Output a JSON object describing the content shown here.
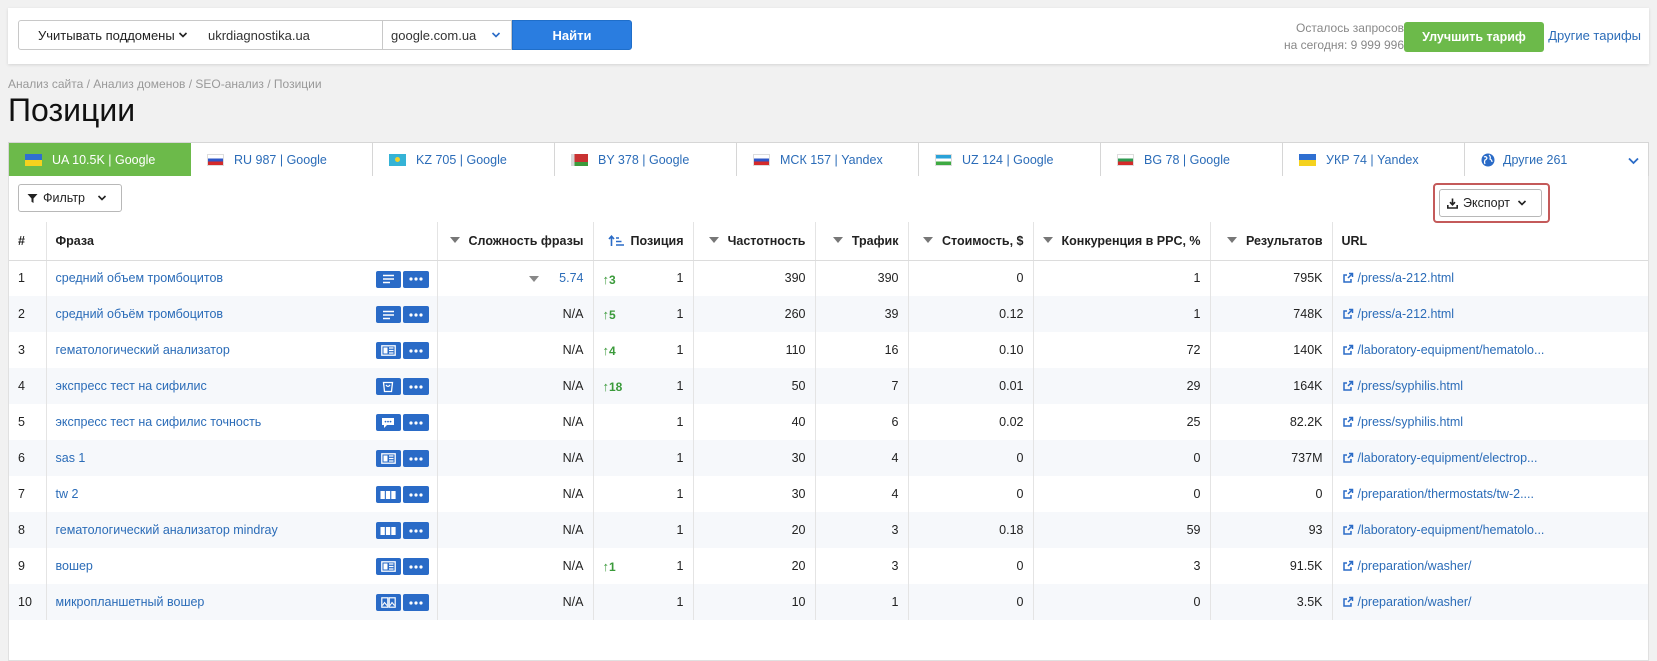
{
  "topbar": {
    "subdomain_select": "Учитывать поддомены",
    "domain_value": "ukrdiagnostika.ua",
    "domain_placeholder": "",
    "engine_select": "google.com.ua",
    "find_button": "Найти",
    "requests_line1": "Осталось запросов",
    "requests_line2": "на сегодня: 9 999 996",
    "upgrade_button": "Улучшить тариф",
    "other_plans_link": "Другие тарифы"
  },
  "breadcrumb": "Анализ сайта / Анализ доменов / SEO-анализ / Позиции",
  "page_title": "Позиции",
  "db_tabs": [
    {
      "label": "UA 10.5K | Google",
      "flag": "flag-ua",
      "active": true
    },
    {
      "label": "RU 987 | Google",
      "flag": "flag-ru"
    },
    {
      "label": "KZ 705 | Google",
      "flag": "flag-kz"
    },
    {
      "label": "BY 378 | Google",
      "flag": "flag-by"
    },
    {
      "label": "МСК 157 | Yandex",
      "flag": "flag-ru"
    },
    {
      "label": "UZ 124 | Google",
      "flag": "flag-uz"
    },
    {
      "label": "BG 78 | Google",
      "flag": "flag-bg"
    },
    {
      "label": "УКР 74 | Yandex",
      "flag": "flag-ua"
    },
    {
      "label": "Другие 261",
      "flag": "globe-icon"
    }
  ],
  "toolbar": {
    "filter_button": "Фильтр",
    "export_button": "Экспорт"
  },
  "table": {
    "headers": {
      "num": "#",
      "phrase": "Фраза",
      "difficulty": "Сложность фразы",
      "position": "Позиция",
      "frequency": "Частотность",
      "traffic": "Трафик",
      "cost": "Стоимость, $",
      "competition": "Конкуренция в PPC, %",
      "results": "Результатов",
      "url": "URL"
    },
    "rows": [
      {
        "n": "1",
        "phrase": "средний объем тромбоцитов",
        "icon": "text-lines-icon",
        "difficulty": "5.74",
        "delta": "3",
        "position": "1",
        "frequency": "390",
        "traffic": "390",
        "cost": "0",
        "competition": "1",
        "results": "795K",
        "url": "/press/a-212.html"
      },
      {
        "n": "2",
        "phrase": "средний объём тромбоцитов",
        "icon": "text-lines-icon",
        "difficulty": "N/A",
        "delta": "5",
        "position": "1",
        "frequency": "260",
        "traffic": "39",
        "cost": "0.12",
        "competition": "1",
        "results": "748K",
        "url": "/press/a-212.html"
      },
      {
        "n": "3",
        "phrase": "гематологический анализатор",
        "icon": "knowledge-panel-icon",
        "difficulty": "N/A",
        "delta": "4",
        "position": "1",
        "frequency": "110",
        "traffic": "16",
        "cost": "0.10",
        "competition": "72",
        "results": "140K",
        "url": "/laboratory-equipment/hematolo..."
      },
      {
        "n": "4",
        "phrase": "экспресс тест на сифилис",
        "icon": "shopping-bag-icon",
        "difficulty": "N/A",
        "delta": "18",
        "position": "1",
        "frequency": "50",
        "traffic": "7",
        "cost": "0.01",
        "competition": "29",
        "results": "164K",
        "url": "/press/syphilis.html"
      },
      {
        "n": "5",
        "phrase": "экспресс тест на сифилис точность",
        "icon": "chat-bubble-icon",
        "difficulty": "N/A",
        "delta": "",
        "position": "1",
        "frequency": "40",
        "traffic": "6",
        "cost": "0.02",
        "competition": "25",
        "results": "82.2K",
        "url": "/press/syphilis.html"
      },
      {
        "n": "6",
        "phrase": "sas 1",
        "icon": "knowledge-panel-icon",
        "difficulty": "N/A",
        "delta": "",
        "position": "1",
        "frequency": "30",
        "traffic": "4",
        "cost": "0",
        "competition": "0",
        "results": "737M",
        "url": "/laboratory-equipment/electrop..."
      },
      {
        "n": "7",
        "phrase": "tw 2",
        "icon": "columns-icon",
        "difficulty": "N/A",
        "delta": "",
        "position": "1",
        "frequency": "30",
        "traffic": "4",
        "cost": "0",
        "competition": "0",
        "results": "0",
        "url": "/preparation/thermostats/tw-2...."
      },
      {
        "n": "8",
        "phrase": "гематологический анализатор mindray",
        "icon": "columns-icon",
        "difficulty": "N/A",
        "delta": "",
        "position": "1",
        "frequency": "20",
        "traffic": "3",
        "cost": "0.18",
        "competition": "59",
        "results": "93",
        "url": "/laboratory-equipment/hematolo..."
      },
      {
        "n": "9",
        "phrase": "вошер",
        "icon": "knowledge-panel-icon",
        "difficulty": "N/A",
        "delta": "1",
        "position": "1",
        "frequency": "20",
        "traffic": "3",
        "cost": "0",
        "competition": "3",
        "results": "91.5K",
        "url": "/preparation/washer/"
      },
      {
        "n": "10",
        "phrase": "микропланшетный вошер",
        "icon": "image-grid-icon",
        "difficulty": "N/A",
        "delta": "",
        "position": "1",
        "frequency": "10",
        "traffic": "1",
        "cost": "0",
        "competition": "0",
        "results": "3.5K",
        "url": "/preparation/washer/"
      }
    ]
  },
  "colors": {
    "accent_blue": "#2a7de0",
    "link_blue": "#2b6cb8",
    "green": "#6cba4a",
    "highlight_red": "#c45a5a"
  }
}
